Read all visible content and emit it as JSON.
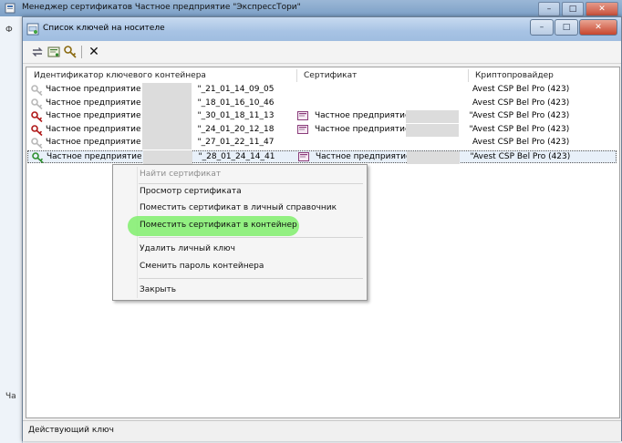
{
  "background_window": {
    "title": "Менеджер сертификатов   Частное предприятие \"ЭкспрессТори\"",
    "left_fragments": [
      "Ф",
      "Ча"
    ],
    "buttons": [
      "–",
      "□",
      "✕"
    ]
  },
  "dialog": {
    "title": "Список ключей на носителе",
    "window_buttons": {
      "minimize": "–",
      "maximize": "□",
      "close": "✕"
    }
  },
  "toolbar": {
    "refresh_icon": "refresh-icon",
    "certificate_icon": "certificate-icon",
    "key_icon": "key-icon",
    "delete_icon": "delete-icon",
    "delete_label": "✕"
  },
  "list": {
    "columns": [
      "Идентификатор ключевого контейнера",
      "Сертификат",
      "Криптопровайдер"
    ],
    "rows": [
      {
        "id_prefix": "Частное предприятие \"",
        "id_suffix": "\"_21_01_14_09_05",
        "certificate": "",
        "provider": "Avest CSP Bel Pro (423)",
        "key_color": "#b8b8b8",
        "selected": false
      },
      {
        "id_prefix": "Частное предприятие \"",
        "id_suffix": "\"_18_01_16_10_46",
        "certificate": "",
        "provider": "Avest CSP Bel Pro (423)",
        "key_color": "#b8b8b8",
        "selected": false
      },
      {
        "id_prefix": "Частное предприятие \"",
        "id_suffix": "\"_30_01_18_11_13",
        "certificate": "Частное предприятие \"",
        "cert_end": "\"",
        "provider": "Avest CSP Bel Pro (423)",
        "key_color": "#b01818",
        "selected": false
      },
      {
        "id_prefix": "Частное предприятие \"",
        "id_suffix": "\"_24_01_20_12_18",
        "certificate": "Частное предприятие \"",
        "cert_end": "\"",
        "provider": "Avest CSP Bel Pro (423)",
        "key_color": "#b01818",
        "selected": false
      },
      {
        "id_prefix": "Частное предприятие \"",
        "id_suffix": "\"_27_01_22_11_47",
        "certificate": "",
        "provider": "Avest CSP Bel Pro (423)",
        "key_color": "#b8b8b8",
        "selected": false
      },
      {
        "id_prefix": "Частное предприятие \"",
        "id_suffix": "\"_28_01_24_14_41",
        "certificate": "Частное предприятие \"",
        "cert_end": "\"",
        "provider": "Avest CSP Bel Pro (423)",
        "key_color": "#2f8f2f",
        "selected": true
      }
    ]
  },
  "context_menu": {
    "items": [
      {
        "label": "Найти сертификат",
        "disabled": true
      },
      {
        "label": "Просмотр сертификата",
        "disabled": false
      },
      {
        "label": "Поместить сертификат в личный справочник",
        "disabled": false
      },
      {
        "label": "Поместить сертификат в контейнер",
        "disabled": false,
        "highlighted": true
      },
      {
        "label": "Удалить личный ключ",
        "disabled": false
      },
      {
        "label": "Сменить пароль контейнера",
        "disabled": false
      },
      {
        "label": "Закрыть",
        "disabled": false
      }
    ]
  },
  "status_bar": {
    "text": "Действующий ключ"
  },
  "colors": {
    "highlight": "#80ee6c",
    "selection": "#e8f0f9",
    "titlebar": "#a7c3e4"
  }
}
